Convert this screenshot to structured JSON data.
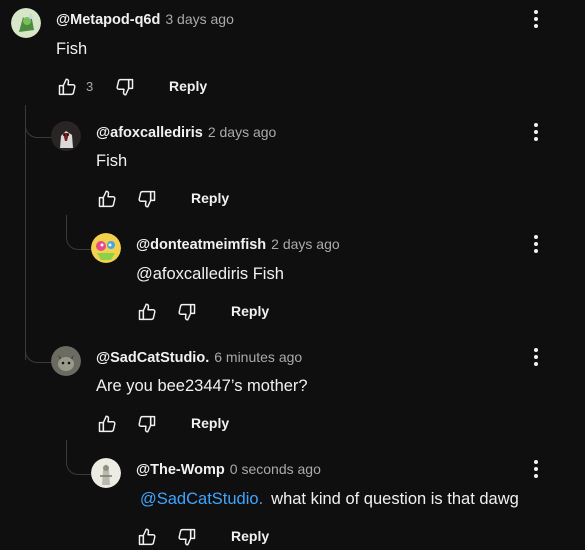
{
  "comments": [
    {
      "author": "@Metapod-q6d",
      "time": "3 days ago",
      "body": "Fish",
      "like_count": "3",
      "reply_label": "Reply",
      "avatar": "avatar-green-character"
    },
    {
      "author": "@afoxcallediris",
      "time": "2 days ago",
      "body": "Fish",
      "like_count": "",
      "reply_label": "Reply",
      "avatar": "avatar-dark-fox"
    },
    {
      "author": "@donteatmeimfish",
      "time": "2 days ago",
      "body": "@afoxcallediris Fish",
      "like_count": "",
      "reply_label": "Reply",
      "avatar": "avatar-colorful-cartoon"
    },
    {
      "author": "@SadCatStudio.",
      "time": "6 minutes ago",
      "body": "Are you bee23447’s mother?",
      "like_count": "",
      "reply_label": "Reply",
      "avatar": "avatar-cat"
    },
    {
      "author": "@The-Womp",
      "time": "0 seconds ago",
      "mention": "@SadCatStudio.",
      "body": "what kind of question is that dawg",
      "like_count": "",
      "reply_label": "Reply",
      "avatar": "avatar-white-figure"
    }
  ],
  "icons": {
    "like": "thumbs-up-icon",
    "dislike": "thumbs-down-icon",
    "menu": "more-vertical-icon"
  },
  "colors": {
    "background": "#0f0f0f",
    "text": "#f1f1f1",
    "secondary_text": "#aaaaaa",
    "mention": "#3ea6ff",
    "thread_line": "#3a3a3a"
  }
}
